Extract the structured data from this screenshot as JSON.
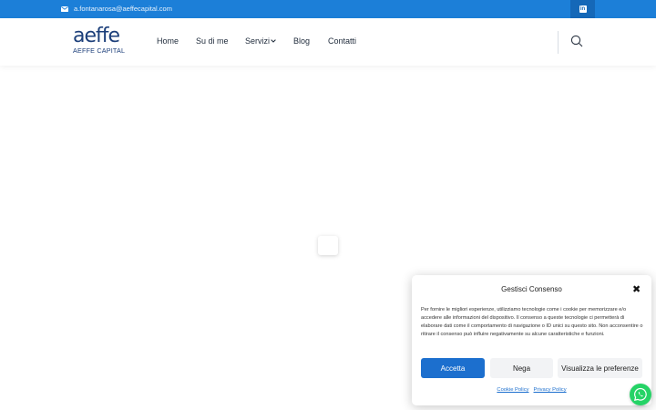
{
  "topbar": {
    "email": "a.fontanarosa@aeffecapital.com",
    "email_icon": "mail-icon",
    "social_icon": "linkedin-icon",
    "color": "#1c7fd8"
  },
  "header": {
    "logo_word": "aeffe",
    "logo_sub": "AEFFE CAPITAL",
    "nav": {
      "home": "Home",
      "su_di_me": "Su di me",
      "servizi": "Servizi",
      "blog": "Blog",
      "contatti": "Contatti"
    },
    "search_icon": "search-icon"
  },
  "consent": {
    "title": "Gestisci Consenso",
    "body": "Per fornire le migliori esperienze, utilizziamo tecnologie come i cookie per memorizzare e/o accedere alle informazioni del dispositivo. Il consenso a queste tecnologie ci permetterà di elaborare dati come il comportamento di navigazione o ID unici su questo sito. Non acconsentire o ritirare il consenso può influire negativamente su alcune caratteristiche e funzioni.",
    "accept": "Accetta",
    "deny": "Nega",
    "preferences": "Visualizza le preferenze",
    "cookie_policy": "Cookie Policy",
    "privacy_policy": "Privacy Policy",
    "accent": "#1c6fce"
  },
  "whatsapp_icon": "whatsapp-icon"
}
